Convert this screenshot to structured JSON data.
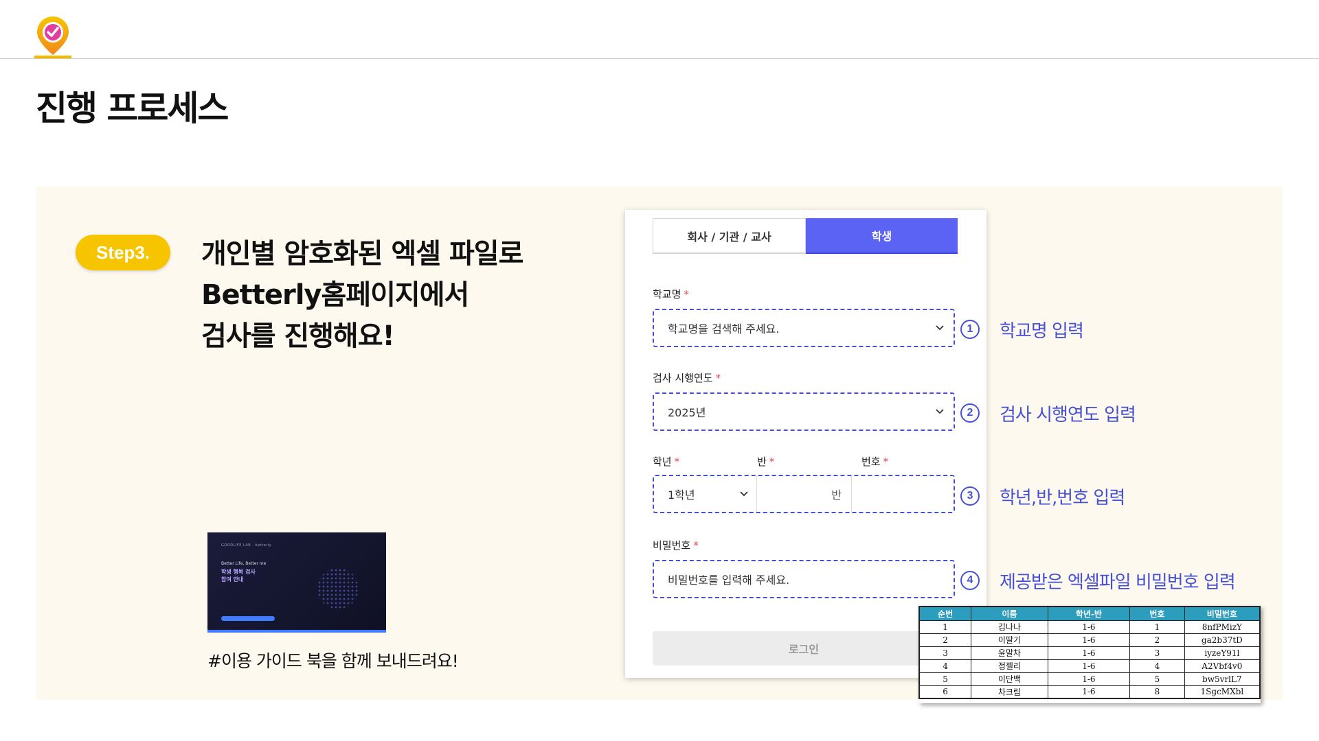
{
  "page": {
    "title": "진행 프로세스"
  },
  "step": {
    "badge": "Step3.",
    "headline": [
      "개인별 암호화된 엑셀 파일로",
      "Betterly홈페이지에서",
      "검사를 진행해요!"
    ]
  },
  "guide": {
    "thumbnail": {
      "brand": "GOODLIFE LAB  ·  betterly",
      "line1": "Better Life, Better me",
      "line2": "학생 행복 검사",
      "line3": "참여 안내"
    },
    "caption": "#이용 가이드 북을 함께 보내드려요!"
  },
  "login_form": {
    "tabs": [
      {
        "label": "회사 / 기관 / 교사",
        "active": false
      },
      {
        "label": "학생",
        "active": true
      }
    ],
    "school": {
      "label": "학교명",
      "required": "*",
      "placeholder": "학교명을 검색해 주세요."
    },
    "year": {
      "label": "검사 시행연도",
      "required": "*",
      "value": "2025년"
    },
    "grade": {
      "label": "학년",
      "required": "*",
      "value": "1학년"
    },
    "class": {
      "label": "반",
      "required": "*",
      "suffix": "반"
    },
    "number": {
      "label": "번호",
      "required": "*"
    },
    "password": {
      "label": "비밀번호",
      "required": "*",
      "placeholder": "비밀번호를 입력해 주세요."
    },
    "login_button": "로그인"
  },
  "annotations": [
    {
      "num": "1",
      "label": "학교명 입력"
    },
    {
      "num": "2",
      "label": "검사 시행연도 입력"
    },
    {
      "num": "3",
      "label": "학년,반,번호 입력"
    },
    {
      "num": "4",
      "label": "제공받은 엑셀파일 비밀번호 입력"
    }
  ],
  "colors": {
    "accent": "#4550d6",
    "tab_active": "#5b63f5",
    "badge": "#f7c500",
    "panel_bg": "#fdf9ee",
    "table_header": "#2d9dbe"
  },
  "password_table": {
    "columns": [
      "순번",
      "이름",
      "학년-반",
      "번호",
      "비밀번호"
    ],
    "rows": [
      [
        "1",
        "김나나",
        "1-6",
        "1",
        "8nfPMizY"
      ],
      [
        "2",
        "이딸기",
        "1-6",
        "2",
        "ga2b37tD"
      ],
      [
        "3",
        "윤말차",
        "1-6",
        "3",
        "iyzeY91l"
      ],
      [
        "4",
        "정젤리",
        "1-6",
        "4",
        "A2Vbf4v0"
      ],
      [
        "5",
        "이단백",
        "1-6",
        "5",
        "bw5vrlL7"
      ],
      [
        "6",
        "차크림",
        "1-6",
        "8",
        "1SgcMXbl"
      ]
    ]
  }
}
